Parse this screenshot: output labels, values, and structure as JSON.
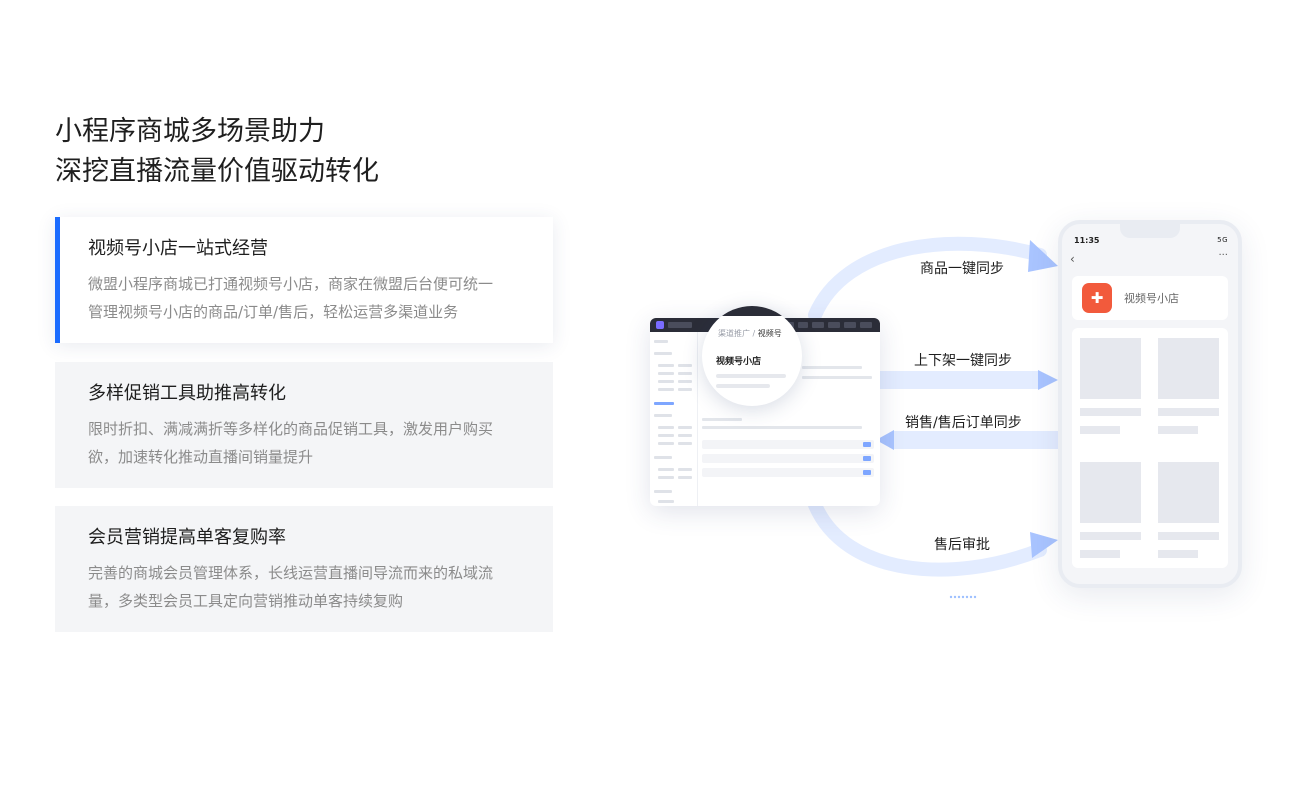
{
  "headline": {
    "line1": "小程序商城多场景助力",
    "line2": "深挖直播流量价值驱动转化"
  },
  "features": [
    {
      "title": "视频号小店一站式经营",
      "desc_line1": "微盟小程序商城已打通视频号小店，商家在微盟后台便可统一",
      "desc_line2": "管理视频号小店的商品/订单/售后，轻松运营多渠道业务",
      "active": true
    },
    {
      "title": "多样促销工具助推高转化",
      "desc_line1": "限时折扣、满减满折等多样化的商品促销工具，激发用户购买",
      "desc_line2": "欲，加速转化推动直播间销量提升",
      "active": false
    },
    {
      "title": "会员营销提高单客复购率",
      "desc_line1": "完善的商城会员管理体系，长线运营直播间导流而来的私域流",
      "desc_line2": "量，多类型会员工具定向营销推动单客持续复购",
      "active": false
    }
  ],
  "flow_labels": {
    "product_sync": "商品一键同步",
    "listing_sync": "上下架一键同步",
    "order_sync": "销售/售后订单同步",
    "after_sale": "售后审批"
  },
  "desktop": {
    "breadcrumb_parent": "渠道推广",
    "breadcrumb_current": "视频号",
    "page_title": "视频号小店"
  },
  "phone": {
    "time": "11:35",
    "signal": "5G",
    "back": "‹",
    "more": "···",
    "shop_name": "视频号小店"
  },
  "colors": {
    "accent": "#1b6cff",
    "arrow": "#a9c4ff",
    "arc": "#dde8ff",
    "shop_icon": "#f25a3c"
  }
}
